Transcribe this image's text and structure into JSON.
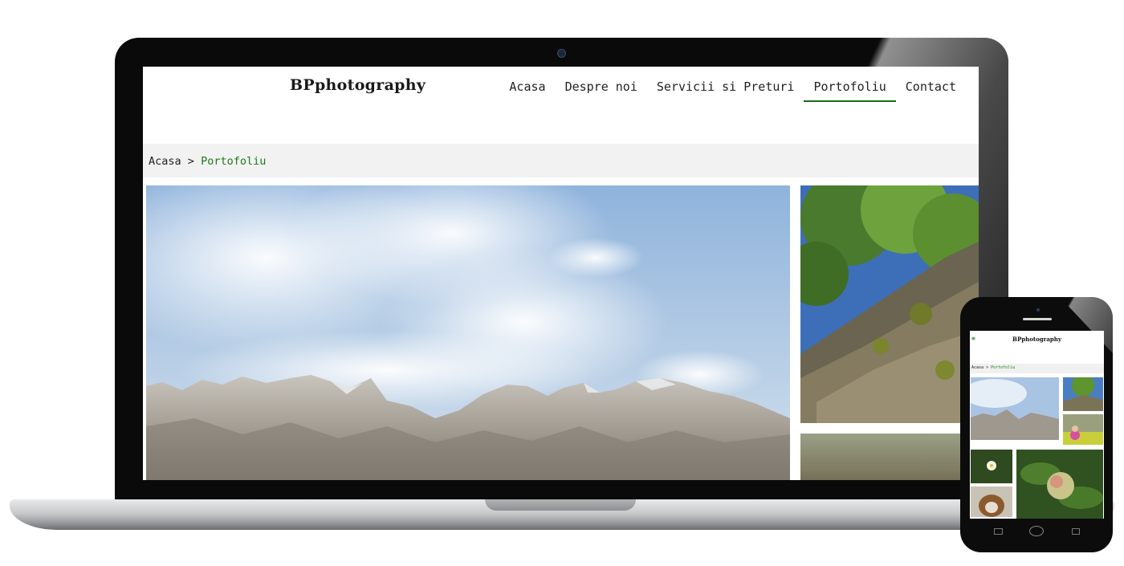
{
  "site": {
    "logo": "BPphotography",
    "nav": [
      "Acasa",
      "Despre noi",
      "Servicii si Preturi",
      "Portofoliu",
      "Contact"
    ],
    "active_nav": "Portofoliu",
    "breadcrumb": {
      "home": "Acasa",
      "separator": ">",
      "current": "Portofoliu"
    }
  },
  "mobile": {
    "menu_icon": "hamburger-icon",
    "logo": "BPphotography",
    "breadcrumb": {
      "home": "Acasa",
      "separator": ">",
      "current": "Portofoliu"
    }
  },
  "colors": {
    "accent_green": "#1a7a1a",
    "breadcrumb_bg": "#f2f2f2"
  }
}
